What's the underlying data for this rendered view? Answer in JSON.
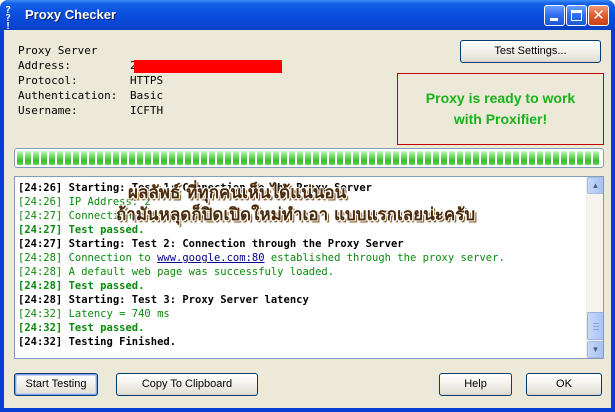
{
  "window": {
    "title": "Proxy Checker",
    "icon_text": [
      "?",
      "?",
      "!"
    ]
  },
  "info": {
    "rows": [
      {
        "label": "Proxy Server",
        "value": ""
      },
      {
        "label": "Address:",
        "value": "2"
      },
      {
        "label": "Protocol:",
        "value": "HTTPS"
      },
      {
        "label": "Authentication:",
        "value": "Basic"
      },
      {
        "label": "Username:",
        "value": "ICFTH"
      }
    ]
  },
  "test_settings_label": "Test Settings...",
  "status": {
    "line1": "Proxy is ready to work",
    "line2": "with Proxifier!",
    "color": "#19b219"
  },
  "progress": {
    "value": 1.0,
    "color": "#3cbb33"
  },
  "log": [
    {
      "style": "bold",
      "text": "[24:26] Starting: Test 1: Connection to the Proxy Server"
    },
    {
      "style": "green",
      "text": "[24:26] IP Address: 2"
    },
    {
      "style": "green",
      "text": "[24:27] Connection established"
    },
    {
      "style": "greenbold",
      "text": "[24:27] Test passed."
    },
    {
      "style": "bold",
      "text": "[24:27] Starting: Test 2: Connection through the Proxy Server"
    },
    {
      "style": "green",
      "pre": "[24:28] Connection to ",
      "link": "www.google.com:80",
      "post": " established through the proxy server."
    },
    {
      "style": "green",
      "text": "[24:28] A default web page was successfuly loaded."
    },
    {
      "style": "greenbold",
      "text": "[24:28] Test passed."
    },
    {
      "style": "bold",
      "text": "[24:28] Starting: Test 3: Proxy Server latency"
    },
    {
      "style": "green",
      "text": "[24:32] Latency = 740 ms"
    },
    {
      "style": "greenbold",
      "text": "[24:32] Test passed."
    },
    {
      "style": "bold",
      "text": "[24:32] Testing Finished."
    }
  ],
  "overlay_text": {
    "line1": "ผลลัพธ์ ที่ทุกคนเห็นได้แน่นอน",
    "line2": "ถ้ามันหลุดก็ปิดเปิดใหม่ทำเอา แบบแรกเลยน่ะครับ"
  },
  "buttons": {
    "start": "Start Testing",
    "copy": "Copy To Clipboard",
    "help": "Help",
    "ok": "OK"
  }
}
